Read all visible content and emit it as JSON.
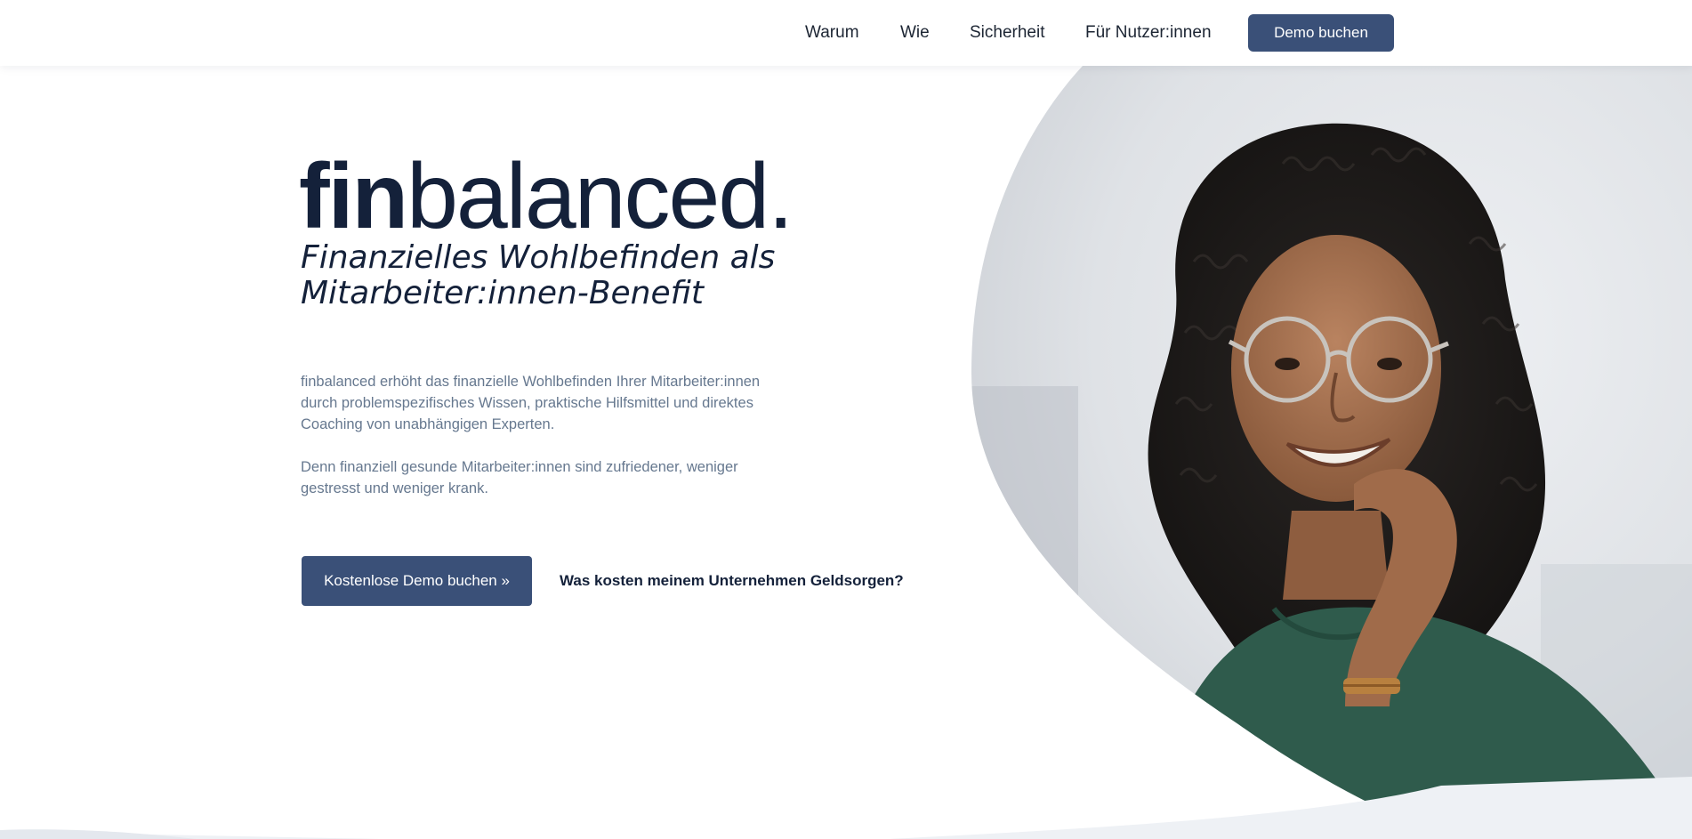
{
  "header": {
    "nav": [
      {
        "label": "Warum"
      },
      {
        "label": "Wie"
      },
      {
        "label": "Sicherheit"
      },
      {
        "label": "Für Nutzer:innen"
      }
    ],
    "cta_label": "Demo buchen"
  },
  "hero": {
    "logo_bold": "fin",
    "logo_light": "balanced.",
    "tagline": "Finanzielles Wohlbefinden als Mitarbeiter:innen-Benefit",
    "description_1": "finbalanced erhöht das finanzielle Wohlbefinden Ihrer Mitarbeiter:innen durch problemspezifisches Wissen, praktische Hilfsmittel und direktes Coaching von unabhängigen Experten.",
    "description_2": "Denn finanziell gesunde Mitarbeiter:innen sind zufriedener, weniger gestresst und weniger krank.",
    "primary_cta": "Kostenlose Demo buchen »",
    "secondary_cta": "Was kosten meinem Unternehmen Geldsorgen?"
  },
  "colors": {
    "brand_navy": "#14213a",
    "button_blue": "#3a5078",
    "body_text": "#66788f"
  }
}
